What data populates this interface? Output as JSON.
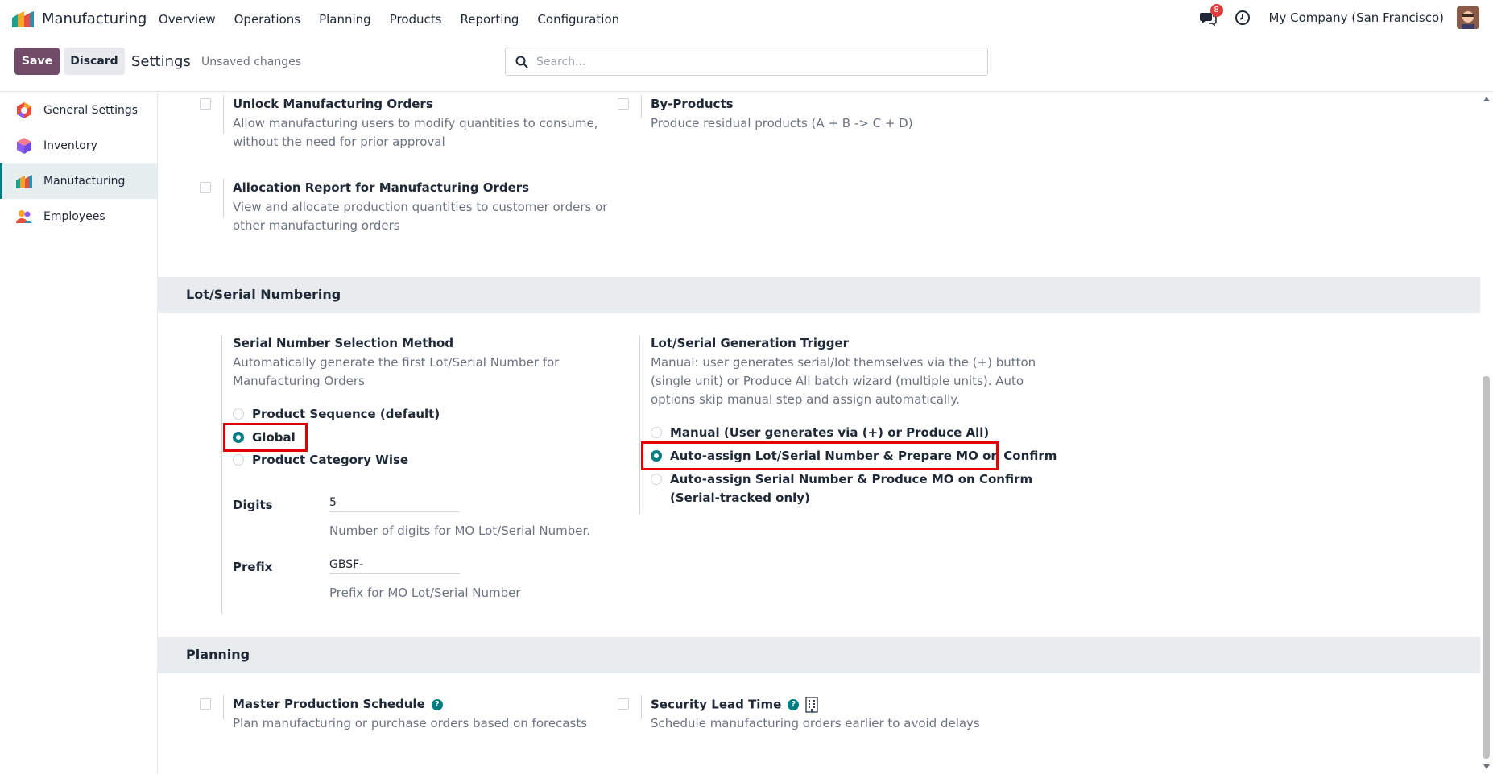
{
  "app": {
    "name": "Manufacturing"
  },
  "menu": [
    "Overview",
    "Operations",
    "Planning",
    "Products",
    "Reporting",
    "Configuration"
  ],
  "topbar": {
    "message_count": "8",
    "company": "My Company (San Francisco)"
  },
  "controls": {
    "save": "Save",
    "discard": "Discard",
    "breadcrumb": "Settings",
    "status": "Unsaved changes",
    "search_placeholder": "Search..."
  },
  "sidebar": [
    {
      "label": "General Settings",
      "icon": "general-settings-icon"
    },
    {
      "label": "Inventory",
      "icon": "inventory-icon"
    },
    {
      "label": "Manufacturing",
      "icon": "manufacturing-icon",
      "active": true
    },
    {
      "label": "Employees",
      "icon": "employees-icon"
    }
  ],
  "settings_top": {
    "unlock": {
      "title": "Unlock Manufacturing Orders",
      "desc1": "Allow manufacturing users to modify quantities to consume,",
      "desc2": "without the need for prior approval",
      "checked": false
    },
    "byproducts": {
      "title": "By-Products",
      "desc": "Produce residual products (A + B -> C + D)",
      "checked": false
    },
    "allocation": {
      "title": "Allocation Report for Manufacturing Orders",
      "desc1": "View and allocate production quantities to customer orders or",
      "desc2": "other manufacturing orders",
      "checked": false
    }
  },
  "lot_section": {
    "heading": "Lot/Serial Numbering",
    "method": {
      "title": "Serial Number Selection Method",
      "desc1": "Automatically generate the first Lot/Serial Number for",
      "desc2": "Manufacturing Orders",
      "options": [
        "Product Sequence (default)",
        "Global",
        "Product Category Wise"
      ],
      "selected": "Global"
    },
    "digits": {
      "label": "Digits",
      "value": "5",
      "help": "Number of digits for MO Lot/Serial Number."
    },
    "prefix": {
      "label": "Prefix",
      "value": "GBSF-",
      "help": "Prefix for MO Lot/Serial Number"
    },
    "trigger": {
      "title": "Lot/Serial Generation Trigger",
      "desc1": "Manual: user generates serial/lot themselves via the (+) button",
      "desc2": "(single unit) or Produce All batch wizard (multiple units). Auto",
      "desc3": "options skip manual step and assign automatically.",
      "opt1": "Manual (User generates via (+) or Produce All)",
      "opt2": "Auto-assign Lot/Serial Number & Prepare MO on Confirm",
      "opt3a": "Auto-assign Serial Number & Produce MO on Confirm",
      "opt3b": "(Serial-tracked only)",
      "selected": "Auto-assign Lot/Serial Number & Prepare MO on Confirm"
    }
  },
  "planning_section": {
    "heading": "Planning",
    "mps": {
      "title": "Master Production Schedule",
      "desc": "Plan manufacturing or purchase orders based on forecasts",
      "checked": false
    },
    "lead": {
      "title": "Security Lead Time",
      "desc": "Schedule manufacturing orders earlier to avoid delays",
      "checked": false
    }
  },
  "colors": {
    "primary": "#714b67",
    "accent": "#017e84",
    "highlight": "#e00000",
    "badge": "#e23b3b"
  }
}
